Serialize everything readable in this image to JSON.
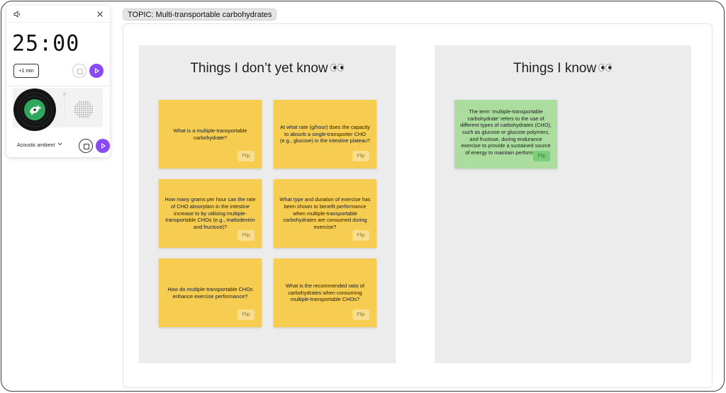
{
  "timer": {
    "time": "25:00",
    "plus_label": "+1 min",
    "music_label": "Acoustic ambient",
    "accent": "#8a4af3"
  },
  "topic": "TOPIC: Multi-transportable carbohydrates",
  "columns": {
    "unknown": {
      "title": "Things I don’t yet know",
      "cards": [
        {
          "text": "What is a multiple-transportable carbohydrate?",
          "flip": "Flip"
        },
        {
          "text": "At what rate (g/hour) does the capacity to absorb a single-transporter CHO (e.g., glucose) in the intestine plateau?",
          "flip": "Flip"
        },
        {
          "text": "How many grams per hour can the rate of CHO absorption in the intestine increase to by utilising multiple-transportable CHOs (e.g., maltodextrin and fructose)?",
          "flip": "Flip"
        },
        {
          "text": "What type and duration of exercise has been shown to benefit performance when multiple-transportable carbohydrates are consumed during exercise?",
          "flip": "Flip"
        },
        {
          "text": "How do multiple-transportable CHOs enhance exercise performance?",
          "flip": "Flip"
        },
        {
          "text": "What is the recommended ratio of carbohydrates when consuming multiple-transportable CHOs?",
          "flip": "Flip"
        }
      ]
    },
    "known": {
      "title": "Things I know",
      "cards": [
        {
          "text": "The term ‘multiple-transportable carbohydrate’ refers to the use of different types of carbohydrates (CHO), such as glucose or glucose polymers, and fructose, during endurance exercise to provide a sustained source of energy to maintain performance.",
          "flip": "Flip"
        }
      ]
    }
  },
  "colors": {
    "card_yellow": "#f6cd50",
    "card_green": "#abdd9f",
    "column_bg": "#ececec"
  }
}
